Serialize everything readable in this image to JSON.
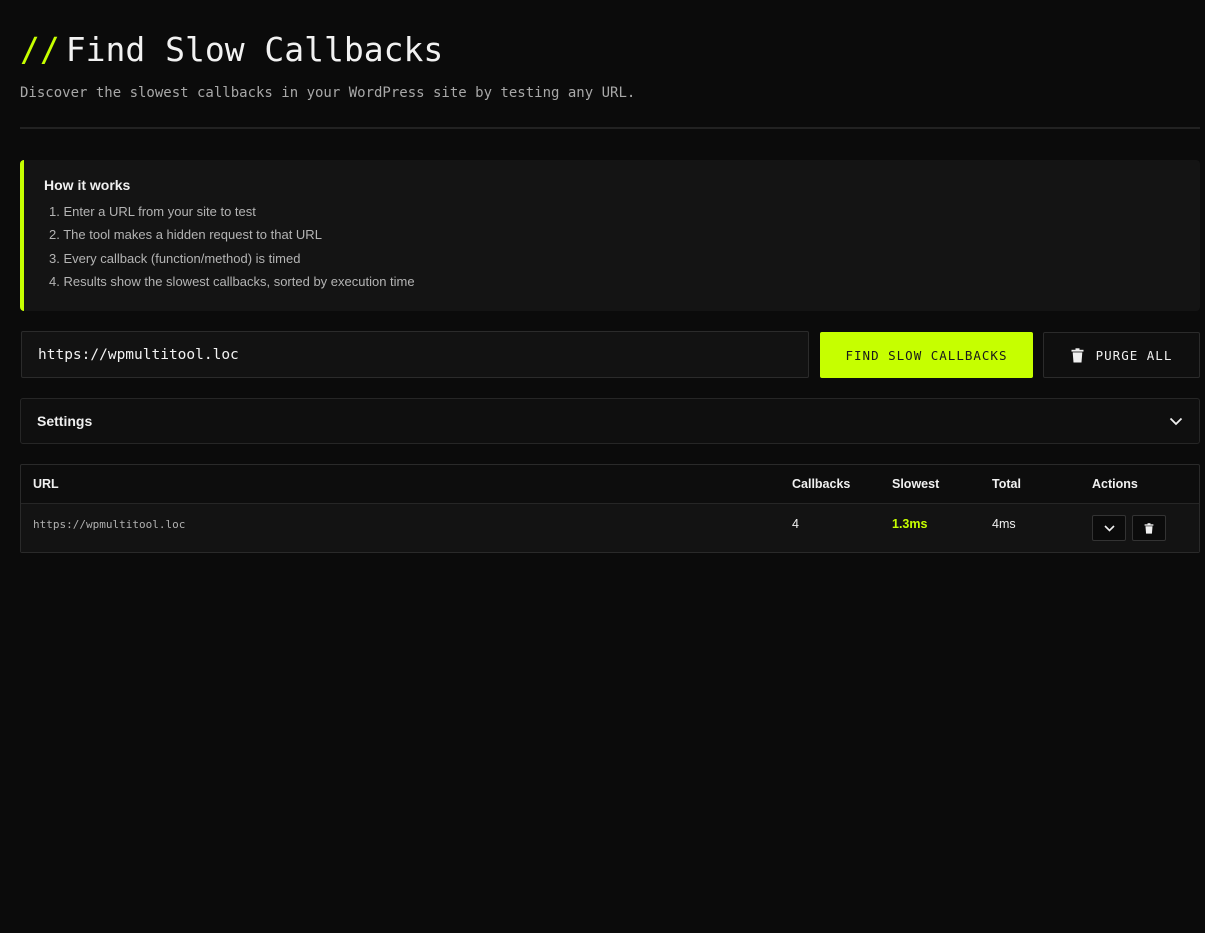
{
  "header": {
    "title_prefix": "//",
    "title": "Find Slow Callbacks",
    "subtitle": "Discover the slowest callbacks in your WordPress site by testing any URL."
  },
  "info": {
    "heading": "How it works",
    "steps": [
      "1. Enter a URL from your site to test",
      "2. The tool makes a hidden request to that URL",
      "3. Every callback (function/method) is timed",
      "4. Results show the slowest callbacks, sorted by execution time"
    ]
  },
  "form": {
    "url_value": "https://wpmultitool.loc",
    "find_label": "FIND SLOW CALLBACKS",
    "purge_label": "PURGE ALL"
  },
  "settings": {
    "label": "Settings"
  },
  "table": {
    "columns": [
      "URL",
      "Callbacks",
      "Slowest",
      "Total",
      "Actions"
    ],
    "rows": [
      {
        "url": "https://wpmultitool.loc",
        "callbacks": "4",
        "slowest": "1.3ms",
        "total": "4ms"
      }
    ]
  },
  "colors": {
    "accent": "#c6ff00",
    "background": "#0b0b0b",
    "panel": "#141414"
  },
  "icons": [
    "trash-icon",
    "chevron-down-icon"
  ]
}
